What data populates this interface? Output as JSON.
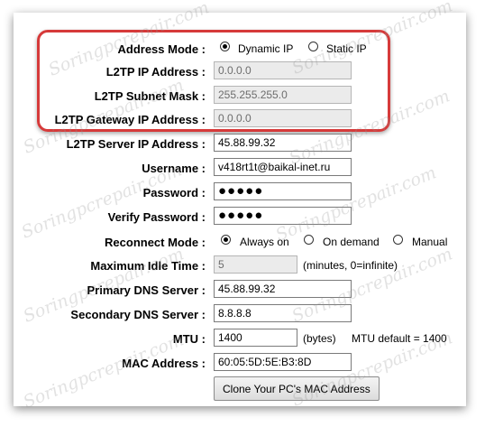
{
  "address_mode": {
    "label": "Address Mode :",
    "options": [
      {
        "label": "Dynamic IP",
        "selected": true
      },
      {
        "label": "Static IP",
        "selected": false
      }
    ]
  },
  "l2tp_ip": {
    "label": "L2TP IP Address :",
    "value": "0.0.0.0",
    "disabled": true
  },
  "l2tp_mask": {
    "label": "L2TP Subnet Mask :",
    "value": "255.255.255.0",
    "disabled": true
  },
  "l2tp_gateway": {
    "label": "L2TP Gateway IP Address :",
    "value": "0.0.0.0",
    "disabled": true
  },
  "l2tp_server": {
    "label": "L2TP Server IP Address :",
    "value": "45.88.99.32"
  },
  "username": {
    "label": "Username :",
    "value": "v418rt1t@baikal-inet.ru"
  },
  "password": {
    "label": "Password :",
    "value": "●●●●●"
  },
  "verify_password": {
    "label": "Verify Password :",
    "value": "●●●●●"
  },
  "reconnect_mode": {
    "label": "Reconnect Mode :",
    "options": [
      {
        "label": "Always on",
        "selected": true
      },
      {
        "label": "On demand",
        "selected": false
      },
      {
        "label": "Manual",
        "selected": false
      }
    ]
  },
  "idle_time": {
    "label": "Maximum Idle Time :",
    "value": "5",
    "disabled": true,
    "note": "(minutes, 0=infinite)"
  },
  "primary_dns": {
    "label": "Primary DNS Server :",
    "value": "45.88.99.32"
  },
  "secondary_dns": {
    "label": "Secondary DNS Server :",
    "value": "8.8.8.8"
  },
  "mtu": {
    "label": "MTU :",
    "value": "1400",
    "unit": "(bytes)",
    "note": "MTU default = 1400"
  },
  "mac": {
    "label": "MAC Address :",
    "value": "60:05:5D:5E:B3:8D"
  },
  "clone_mac_button": {
    "label": "Clone Your PC's MAC Address"
  },
  "watermark": "Soringpcrepair.com",
  "colors": {
    "highlight": "#d63a3a",
    "disabled_bg": "#ebebeb"
  }
}
